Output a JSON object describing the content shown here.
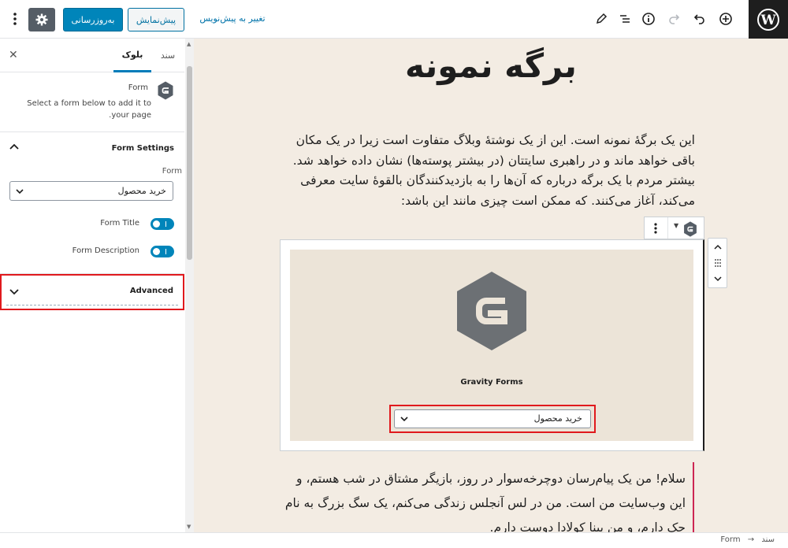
{
  "header": {
    "switch_to_draft": "تغییر به پیش‌نویس",
    "preview_label": "پیش‌نمایش",
    "update_label": "به‌روزرسانی"
  },
  "sidebar": {
    "tabs": {
      "document": "سند",
      "block": "بلوک"
    },
    "block_card": {
      "title": "Form",
      "description": "Select a form below to add it to your page."
    },
    "form_settings": {
      "title": "Form Settings",
      "form_label": "Form",
      "selected_form": "خرید محصول",
      "form_title_label": "Form Title",
      "form_title_enabled": true,
      "form_description_label": "Form Description",
      "form_description_enabled": true
    },
    "advanced": {
      "title": "Advanced"
    }
  },
  "editor": {
    "page_title": "برگه نمونه",
    "paragraph1": "این یک برگهٔ نمونه است. این از یک نوشتهٔ وبلاگ متفاوت است زیرا در یک مکان باقی خواهد ماند و در راهبری سایتتان (در بیشتر پوسته‌ها) نشان داده خواهد شد. بیشتر مردم با یک برگه درباره که آن‌ها را به بازدیدکنندگان بالقوهٔ سایت معرفی می‌کند، آغاز می‌کنند. که ممکن است چیزی مانند این باشد:",
    "gravity_block": {
      "name": "Gravity Forms",
      "selected_form": "خرید محصول"
    },
    "paragraph2": "سلام! من یک پیام‌رسان دوچرخه‌سوار در روز، بازیگر مشتاق در شب هستم، و این وب‌سایت من است. من در لس آنجلس زندگی می‌کنم، یک سگ بزرگ به نام جک دارم، و من پینا کولادا دوست دارم."
  },
  "footer": {
    "breadcrumb": {
      "root": "سند",
      "arrow": "→",
      "current": "Form"
    }
  },
  "colors": {
    "accent": "#0085ba",
    "highlight": "#e0191d",
    "canvas": "#f3ece3"
  }
}
